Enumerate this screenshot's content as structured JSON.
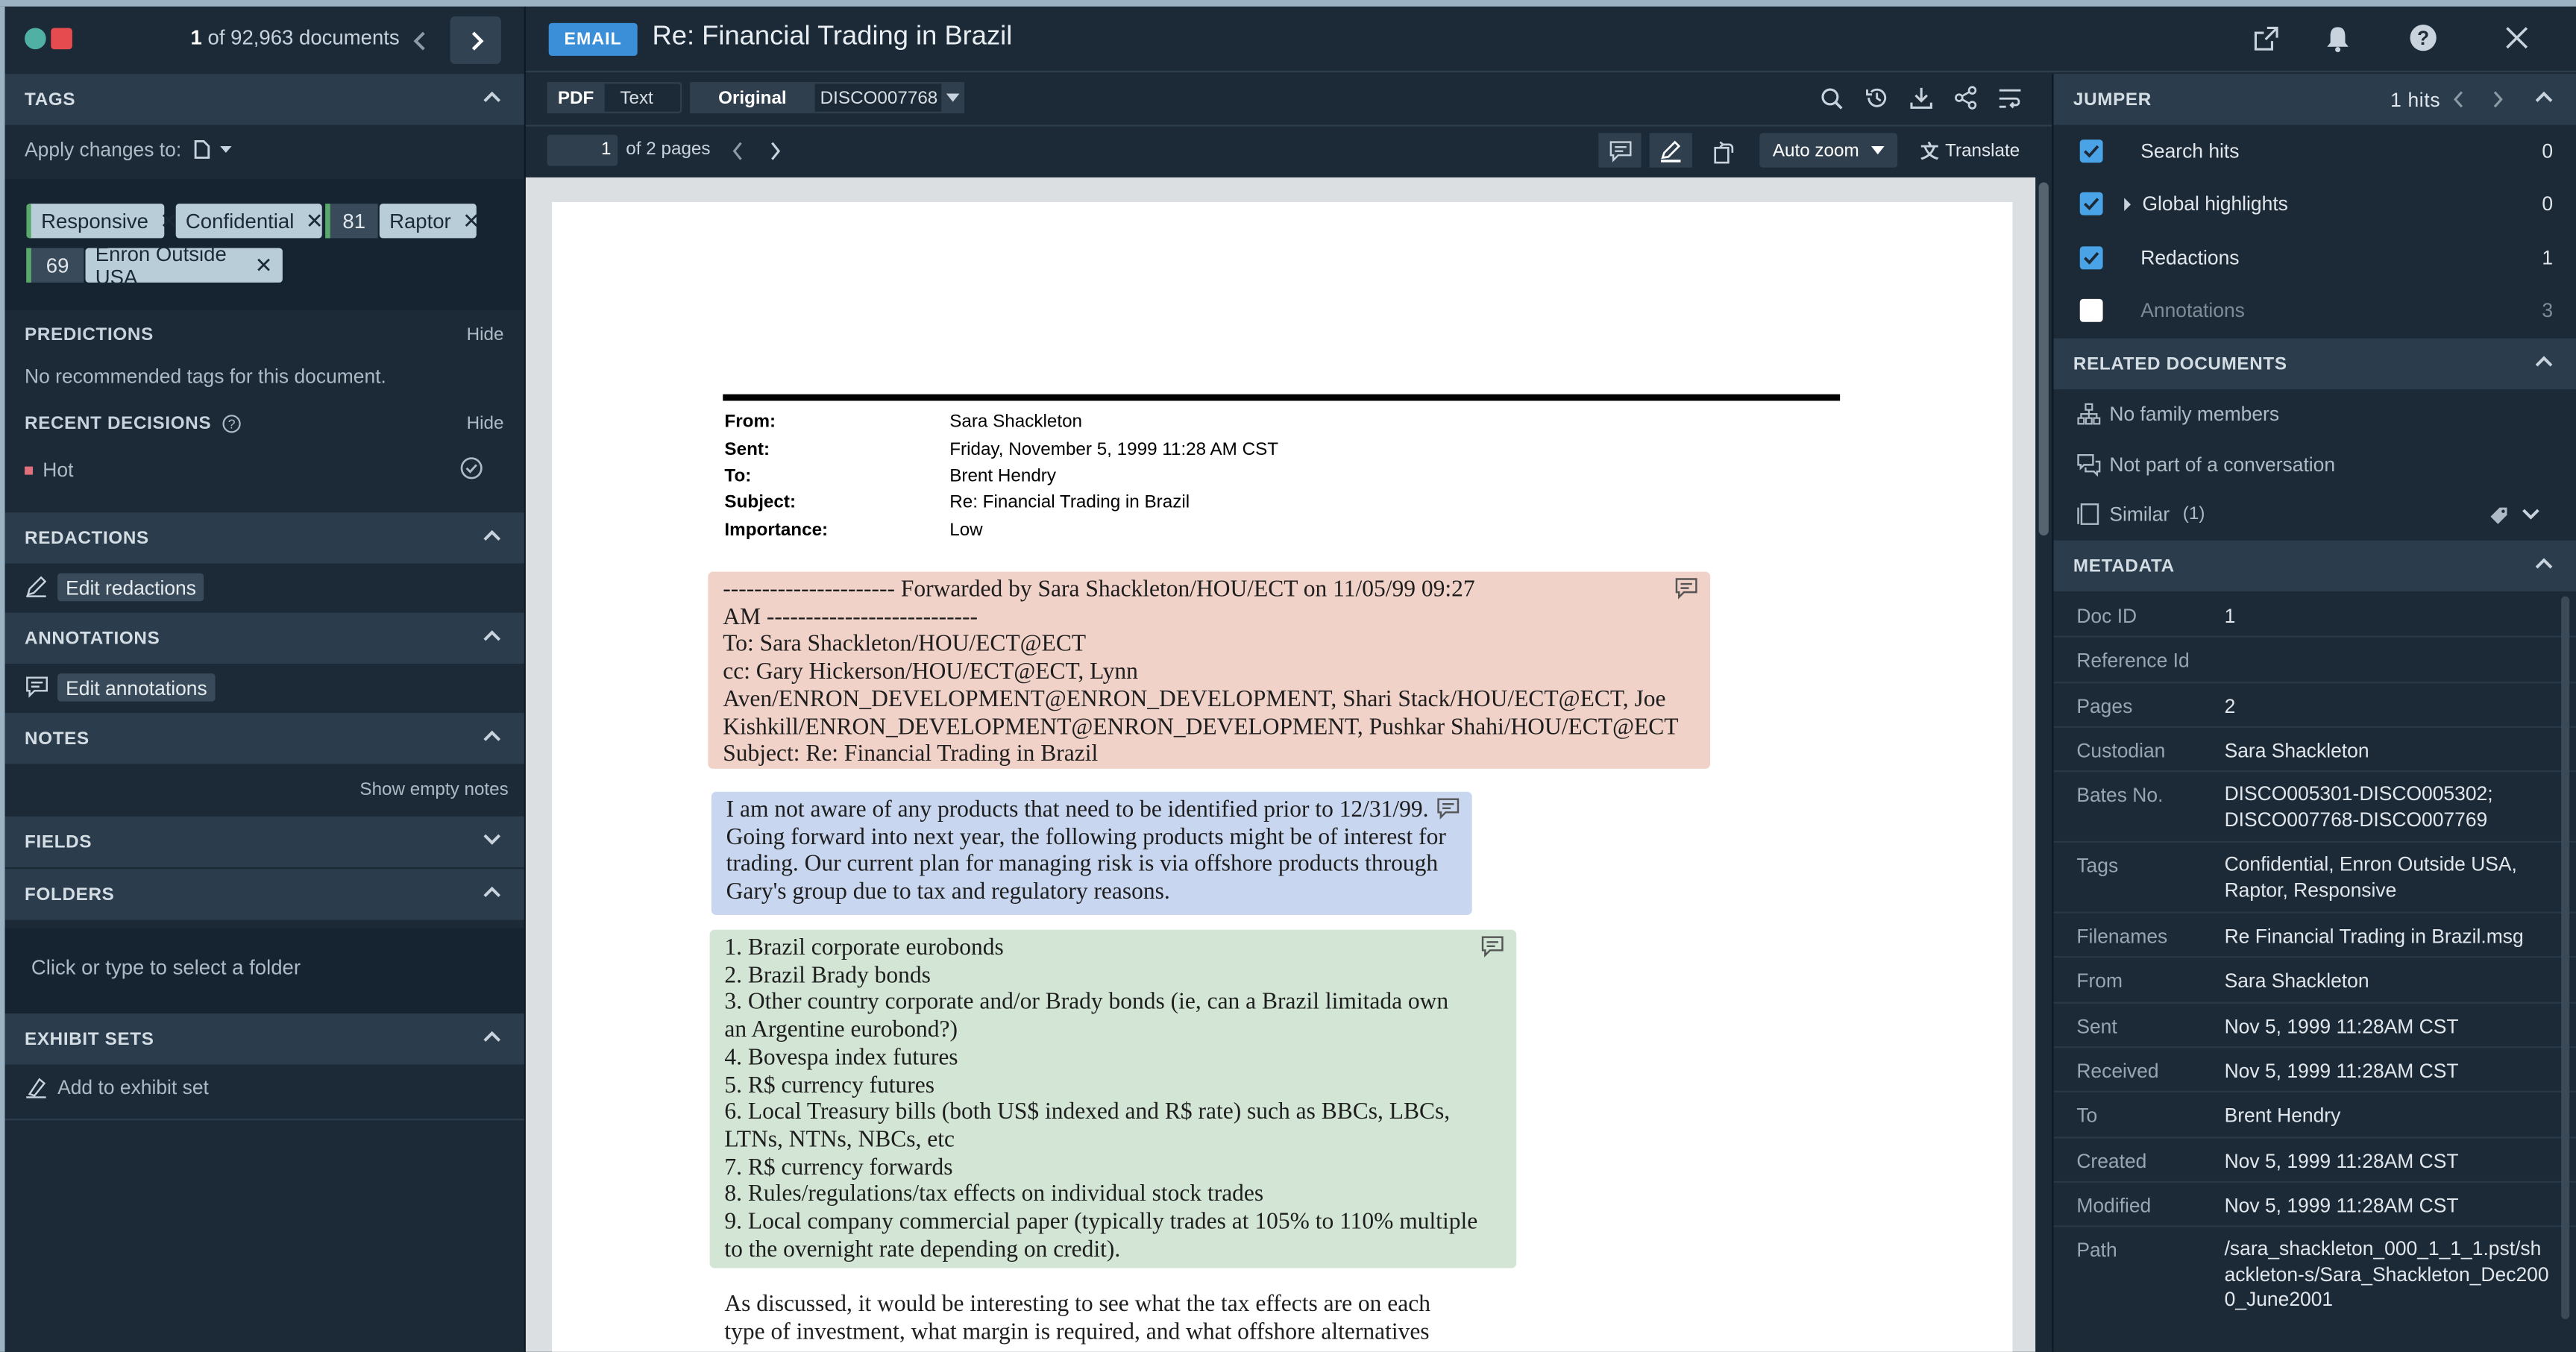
{
  "window": {
    "dots_colors": [
      "#4fb0a3",
      "#e64c4f"
    ]
  },
  "nav": {
    "position": "1",
    "count_text": "of 92,963 documents"
  },
  "doc_header": {
    "type_badge": "EMAIL",
    "title": "Re: Financial Trading in Brazil"
  },
  "left": {
    "tags": {
      "header": "TAGS",
      "apply_label": "Apply changes to:",
      "pills": [
        {
          "label": "Responsive"
        },
        {
          "label": "Confidential"
        },
        {
          "num": "81",
          "label": "Raptor"
        },
        {
          "num": "69",
          "label": "Enron Outside USA"
        }
      ]
    },
    "predictions": {
      "header": "PREDICTIONS",
      "hide": "Hide",
      "text": "No recommended tags for this document."
    },
    "recent": {
      "header": "RECENT DECISIONS",
      "hide": "Hide",
      "item": "Hot"
    },
    "redactions": {
      "header": "REDACTIONS",
      "button": "Edit redactions"
    },
    "annotations": {
      "header": "ANNOTATIONS",
      "button": "Edit annotations"
    },
    "notes": {
      "header": "NOTES",
      "link": "Show empty notes"
    },
    "fields": {
      "header": "FIELDS"
    },
    "folders": {
      "header": "FOLDERS",
      "placeholder": "Click or type to select a folder"
    },
    "exhibit": {
      "header": "EXHIBIT SETS",
      "button": "Add to exhibit set"
    }
  },
  "viewer": {
    "tabs": [
      "PDF",
      "Text"
    ],
    "version": [
      "Original",
      "DISCO007768"
    ],
    "page_num": "1",
    "page_of": "of",
    "page_total": "2",
    "pages_label": "pages",
    "zoom": "Auto zoom",
    "translate": "Translate"
  },
  "email": {
    "fields": [
      {
        "k": "From:",
        "v": "Sara Shackleton"
      },
      {
        "k": "Sent:",
        "v": "Friday, November 5, 1999 11:28 AM CST"
      },
      {
        "k": "To:",
        "v": "Brent Hendry"
      },
      {
        "k": "Subject:",
        "v": "Re: Financial Trading in Brazil"
      },
      {
        "k": "Importance:",
        "v": "Low"
      }
    ],
    "block_red": [
      "---------------------- Forwarded by Sara Shackleton/HOU/ECT on 11/05/99 09:27",
      "AM ---------------------------",
      "To: Sara Shackleton/HOU/ECT@ECT",
      "cc: Gary Hickerson/HOU/ECT@ECT, Lynn",
      "Aven/ENRON_DEVELOPMENT@ENRON_DEVELOPMENT, Shari Stack/HOU/ECT@ECT, Joe",
      "Kishkill/ENRON_DEVELOPMENT@ENRON_DEVELOPMENT, Pushkar Shahi/HOU/ECT@ECT",
      "Subject: Re: Financial Trading in Brazil"
    ],
    "block_blue": [
      "I am not aware of any products that need to be identified prior to 12/31/99.",
      "Going forward into next year, the following products might be of interest for",
      "trading.  Our current plan for managing risk is via offshore products through",
      "Gary's group due to tax and regulatory reasons."
    ],
    "block_green": [
      "1. Brazil corporate eurobonds",
      "2. Brazil Brady bonds",
      "3. Other country corporate and/or Brady bonds (ie, can a Brazil limitada own",
      "an Argentine eurobond?)",
      "4. Bovespa index futures",
      "5. R$ currency futures",
      "6. Local Treasury bills (both US$ indexed and R$ rate) such as BBCs, LBCs,",
      "LTNs, NTNs, NBCs, etc",
      "7. R$ currency forwards",
      "8. Rules/regulations/tax effects on individual stock trades",
      "9. Local company commercial paper (typically trades at 105% to 110% multiple",
      "to the overnight rate depending on credit)."
    ],
    "tail": [
      "As discussed, it would be interesting to see what the tax effects are on each",
      "type of investment, what margin is required, and what offshore alternatives"
    ],
    "colors": {
      "red": "#f1d2c9",
      "blue": "#c8d6ef",
      "green": "#d3e6d6"
    }
  },
  "right": {
    "jumper": {
      "header": "JUMPER",
      "hits": "1 hits",
      "rows": [
        {
          "label": "Search hits",
          "count": "0",
          "checked": true
        },
        {
          "label": "Global highlights",
          "count": "0",
          "checked": true
        },
        {
          "label": "Redactions",
          "count": "1",
          "checked": true
        },
        {
          "label": "Annotations",
          "count": "3",
          "checked": false
        }
      ]
    },
    "related": {
      "header": "RELATED DOCUMENTS",
      "family": "No family members",
      "conversation": "Not part of a conversation",
      "similar": "Similar",
      "similar_count": "(1)"
    },
    "metadata": {
      "header": "METADATA",
      "rows": [
        {
          "k": "Doc ID",
          "v": "1"
        },
        {
          "k": "Reference Id",
          "v": ""
        },
        {
          "k": "Pages",
          "v": "2"
        },
        {
          "k": "Custodian",
          "v": "Sara Shackleton"
        },
        {
          "k": "Bates No.",
          "v": "DISCO005301-DISCO005302; DISCO007768-DISCO007769"
        },
        {
          "k": "Tags",
          "v": "Confidential, Enron Outside USA, Raptor, Responsive"
        },
        {
          "k": "Filenames",
          "v": "Re Financial Trading in Brazil.msg"
        },
        {
          "k": "From",
          "v": "Sara Shackleton"
        },
        {
          "k": "Sent",
          "v": "Nov 5, 1999 11:28AM CST"
        },
        {
          "k": "Received",
          "v": "Nov 5, 1999 11:28AM CST"
        },
        {
          "k": "To",
          "v": "Brent Hendry"
        },
        {
          "k": "Created",
          "v": "Nov 5, 1999 11:28AM CST"
        },
        {
          "k": "Modified",
          "v": "Nov 5, 1999 11:28AM CST"
        },
        {
          "k": "Path",
          "v": "/sara_shackleton_000_1_1_1.pst/shackleton-s/Sara_Shackleton_Dec2000_June2001"
        }
      ]
    }
  }
}
